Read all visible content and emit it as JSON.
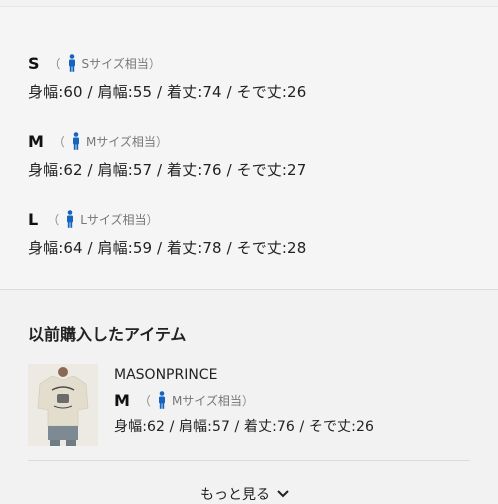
{
  "sizes": [
    {
      "letter": "S",
      "note": "Sサイズ相当",
      "measurements": "身幅:60 / 肩幅:55 / 着丈:74 / そで丈:26"
    },
    {
      "letter": "M",
      "note": "Mサイズ相当",
      "measurements": "身幅:62 / 肩幅:57 / 着丈:76 / そで丈:27"
    },
    {
      "letter": "L",
      "note": "Lサイズ相当",
      "measurements": "身幅:64 / 肩幅:59 / 着丈:78 / そで丈:28"
    }
  ],
  "paren_open": "（",
  "paren_close": "）",
  "purchased": {
    "title": "以前購入したアイテム",
    "item": {
      "brand": "MASONPRINCE",
      "size_letter": "M",
      "size_note": "Mサイズ相当",
      "measurements": "身幅:62 / 肩幅:57 / 着丈:76 / そで丈:26"
    },
    "more_label": "もっと見る"
  },
  "colors": {
    "accent": "#1565c0",
    "text": "#222222",
    "muted": "#777777"
  },
  "icons": {
    "person": "person-icon",
    "more": "chevron-down-icon"
  }
}
